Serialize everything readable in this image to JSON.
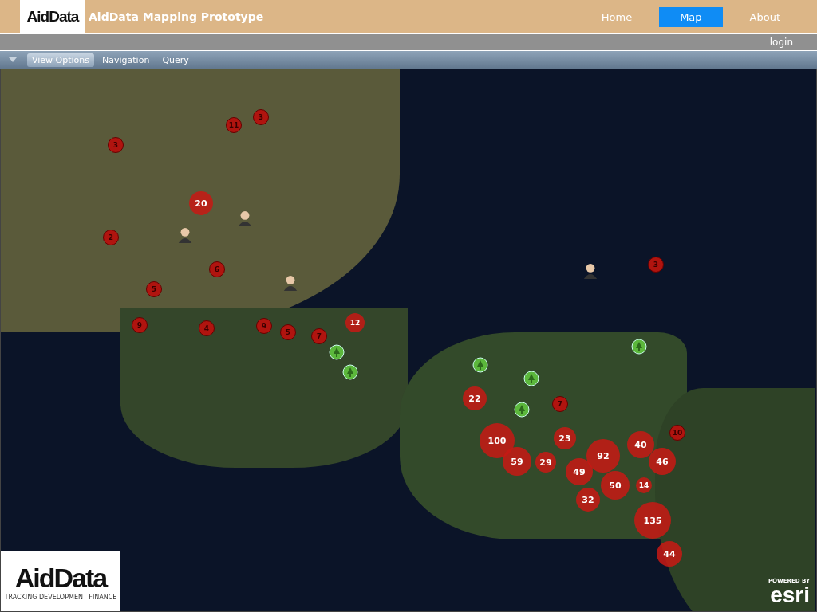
{
  "header": {
    "logo": "AidData",
    "title": "AidData Mapping Prototype",
    "nav": [
      {
        "label": "Home",
        "selected": false
      },
      {
        "label": "Map",
        "selected": true
      },
      {
        "label": "About",
        "selected": false
      }
    ]
  },
  "user_bar": {
    "login": "login"
  },
  "toolbar": {
    "tabs": [
      {
        "label": "View Options",
        "selected": true
      },
      {
        "label": "Navigation",
        "selected": false
      },
      {
        "label": "Query",
        "selected": false
      }
    ]
  },
  "map": {
    "clusters": [
      {
        "count": "11",
        "kind": "small"
      },
      {
        "count": "3",
        "kind": "small"
      },
      {
        "count": "3",
        "kind": "small"
      },
      {
        "count": "20",
        "kind": "large"
      },
      {
        "count": "2",
        "kind": "small"
      },
      {
        "count": "6",
        "kind": "small"
      },
      {
        "count": "5",
        "kind": "small"
      },
      {
        "count": "9",
        "kind": "small"
      },
      {
        "count": "4",
        "kind": "small"
      },
      {
        "count": "9",
        "kind": "small"
      },
      {
        "count": "5",
        "kind": "small"
      },
      {
        "count": "7",
        "kind": "small"
      },
      {
        "count": "12",
        "kind": "large"
      },
      {
        "count": "22",
        "kind": "large"
      },
      {
        "count": "100",
        "kind": "large"
      },
      {
        "count": "23",
        "kind": "large"
      },
      {
        "count": "59",
        "kind": "large"
      },
      {
        "count": "29",
        "kind": "large"
      },
      {
        "count": "40",
        "kind": "large"
      },
      {
        "count": "92",
        "kind": "large"
      },
      {
        "count": "46",
        "kind": "large"
      },
      {
        "count": "49",
        "kind": "large"
      },
      {
        "count": "50",
        "kind": "large"
      },
      {
        "count": "14",
        "kind": "large"
      },
      {
        "count": "32",
        "kind": "large"
      },
      {
        "count": "135",
        "kind": "large"
      },
      {
        "count": "44",
        "kind": "large"
      },
      {
        "count": "10",
        "kind": "small"
      },
      {
        "count": "7",
        "kind": "small"
      },
      {
        "count": "3",
        "kind": "small"
      }
    ],
    "bottom_logo": {
      "name": "AidData",
      "tagline": "TRACKING DEVELOPMENT FINANCE"
    },
    "attribution": {
      "powered_by": "POWERED BY",
      "brand": "esri"
    }
  }
}
